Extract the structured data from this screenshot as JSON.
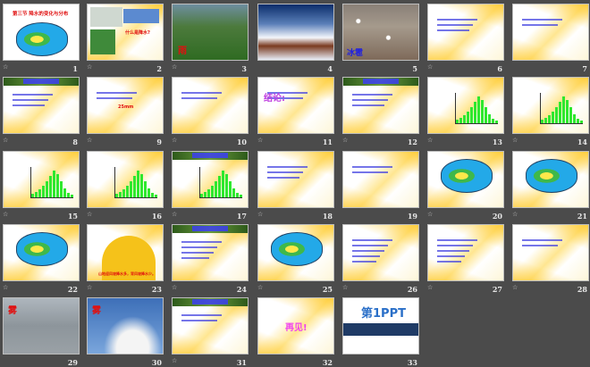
{
  "view": "slide-sorter",
  "animation_icon": "animation-star-icon",
  "slides": [
    {
      "number": "1",
      "style": "white",
      "title": "第三节 降水的变化与分布",
      "title_color": "red",
      "map": true,
      "anim": true
    },
    {
      "number": "2",
      "style": "collage",
      "title": "什么是降水?",
      "title_color": "red",
      "anim": true
    },
    {
      "number": "3",
      "style": "photo-rain",
      "title": "雨",
      "title_color": "red",
      "anim": true
    },
    {
      "number": "4",
      "style": "photo-snow",
      "title": "",
      "anim": false
    },
    {
      "number": "5",
      "style": "photo-hail",
      "title": "冰雹",
      "title_color": "blue",
      "anim": false
    },
    {
      "number": "6",
      "style": "yellow",
      "title": "",
      "lines": 3,
      "anim": true
    },
    {
      "number": "7",
      "style": "yellow",
      "title": "",
      "lines": 2,
      "anim": false
    },
    {
      "number": "8",
      "style": "yellow",
      "banner": true,
      "title": "",
      "lines": 3,
      "anim": true
    },
    {
      "number": "9",
      "style": "yellow",
      "title": "25mm",
      "title_color": "red",
      "lines": 2,
      "anim": true
    },
    {
      "number": "10",
      "style": "yellow",
      "title": "",
      "lines": 2,
      "anim": true
    },
    {
      "number": "11",
      "style": "yellow",
      "title": "结论:",
      "title_color": "purple",
      "lines": 2,
      "anim": true
    },
    {
      "number": "12",
      "style": "yellow",
      "banner": true,
      "title": "",
      "lines": 3,
      "anim": true
    },
    {
      "number": "13",
      "style": "yellow",
      "title": "",
      "chart": true,
      "anim": true
    },
    {
      "number": "14",
      "style": "yellow",
      "title": "",
      "chart": true,
      "anim": true
    },
    {
      "number": "15",
      "style": "yellow",
      "title": "",
      "chart": true,
      "anim": true
    },
    {
      "number": "16",
      "style": "yellow",
      "title": "",
      "chart": true,
      "anim": true
    },
    {
      "number": "17",
      "style": "yellow",
      "banner": true,
      "title": "",
      "chart": true,
      "anim": true
    },
    {
      "number": "18",
      "style": "yellow",
      "title": "",
      "lines": 3,
      "anim": true
    },
    {
      "number": "19",
      "style": "yellow",
      "title": "",
      "lines": 2,
      "anim": false
    },
    {
      "number": "20",
      "style": "yellow",
      "title": "",
      "map": true,
      "anim": true
    },
    {
      "number": "21",
      "style": "yellow",
      "title": "",
      "map": true,
      "anim": true
    },
    {
      "number": "22",
      "style": "yellow",
      "title": "",
      "map": true,
      "anim": true
    },
    {
      "number": "23",
      "style": "yellow",
      "title": "山地迎风坡降水多，背风坡降水少。",
      "title_color": "red",
      "mountain": true,
      "anim": true
    },
    {
      "number": "24",
      "style": "yellow",
      "banner": true,
      "title": "",
      "lines": 4,
      "anim": true
    },
    {
      "number": "25",
      "style": "yellow",
      "title": "",
      "map": true,
      "anim": true
    },
    {
      "number": "26",
      "style": "yellow",
      "title": "",
      "lines": 5,
      "anim": true
    },
    {
      "number": "27",
      "style": "yellow",
      "title": "",
      "lines": 5,
      "anim": true
    },
    {
      "number": "28",
      "style": "yellow",
      "title": "",
      "lines": 2,
      "anim": true
    },
    {
      "number": "29",
      "style": "photo-fog",
      "title": "雾",
      "title_color": "red",
      "anim": false
    },
    {
      "number": "30",
      "style": "photo-rime",
      "title": "雾",
      "title_color": "red",
      "anim": false
    },
    {
      "number": "31",
      "style": "yellow",
      "banner": true,
      "title": "",
      "lines": 2,
      "anim": true
    },
    {
      "number": "32",
      "style": "yellow",
      "title": "再见!",
      "title_color": "pink",
      "anim": false
    },
    {
      "number": "33",
      "style": "ppt",
      "title": "第1PPT",
      "title_color": "blue",
      "anim": false
    }
  ]
}
